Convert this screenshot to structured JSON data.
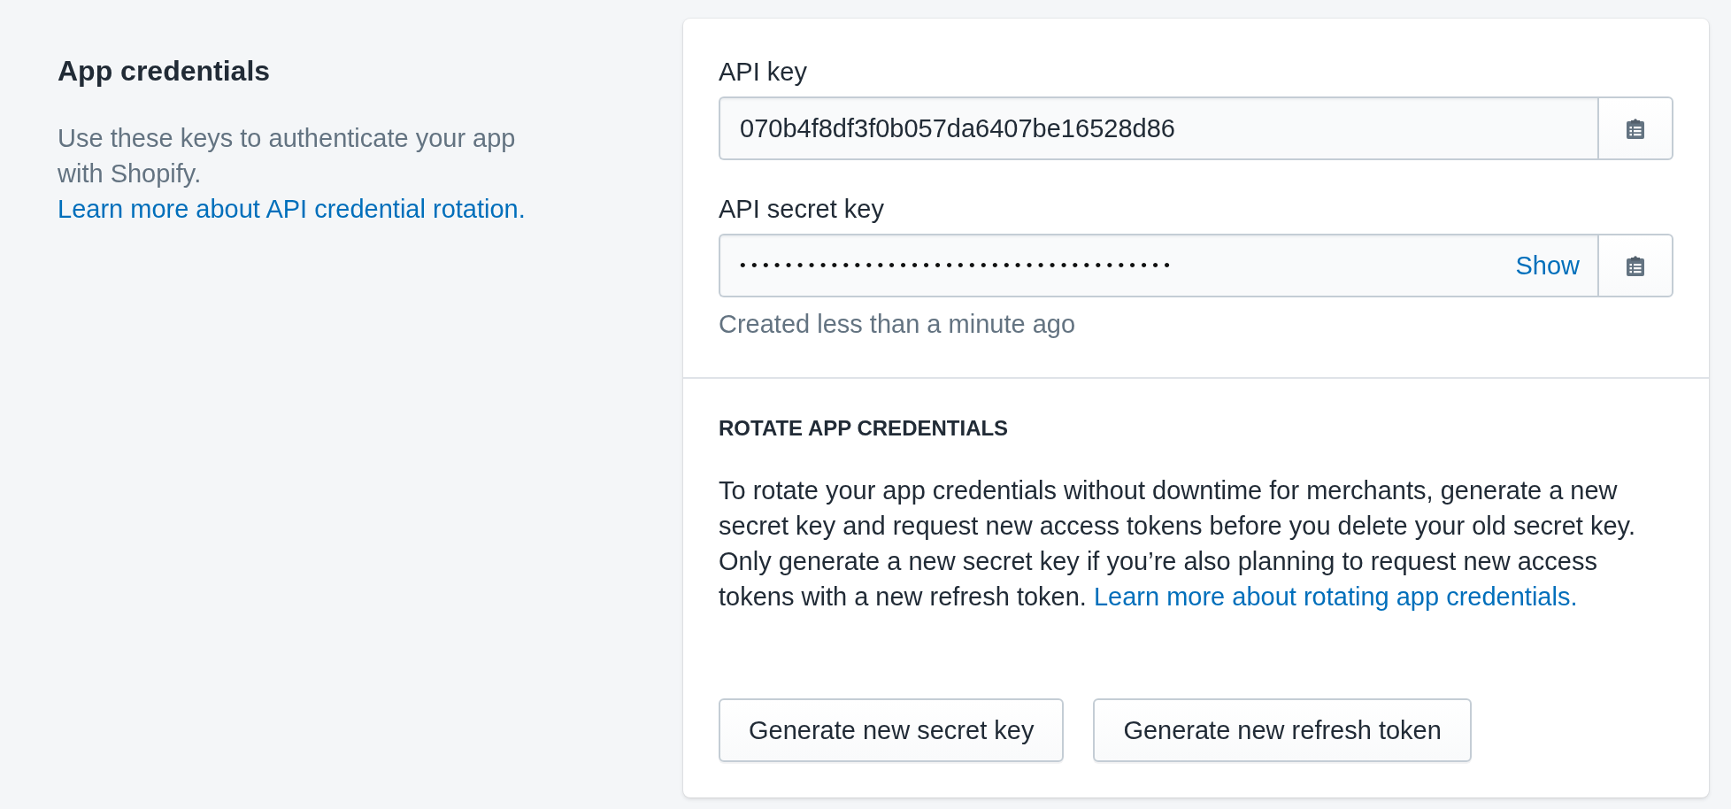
{
  "annotation": {
    "title": "App credentials",
    "description": "Use these keys to authenticate your app with Shopify.",
    "link": "Learn more about API credential rotation."
  },
  "credentials": {
    "fields": [
      {
        "kind": "plain",
        "label": "API key",
        "value": "070b4f8df3f0b057da6407be16528d86"
      },
      {
        "kind": "secret",
        "label": "API secret key",
        "value": "••••••••••••••••••••••••••••••••••••••",
        "toggle": "Show",
        "help": "Created less than a minute ago"
      }
    ]
  },
  "rotate": {
    "title": "ROTATE APP CREDENTIALS",
    "text": "To rotate your app credentials without downtime for merchants, generate a new secret key and request new access tokens before you delete your old secret key. Only generate a new secret key if you’re also planning to request new access tokens with a new refresh token.",
    "link": "Learn more about rotating app credentials.",
    "buttons": [
      "Generate new secret key",
      "Generate new refresh token"
    ]
  }
}
